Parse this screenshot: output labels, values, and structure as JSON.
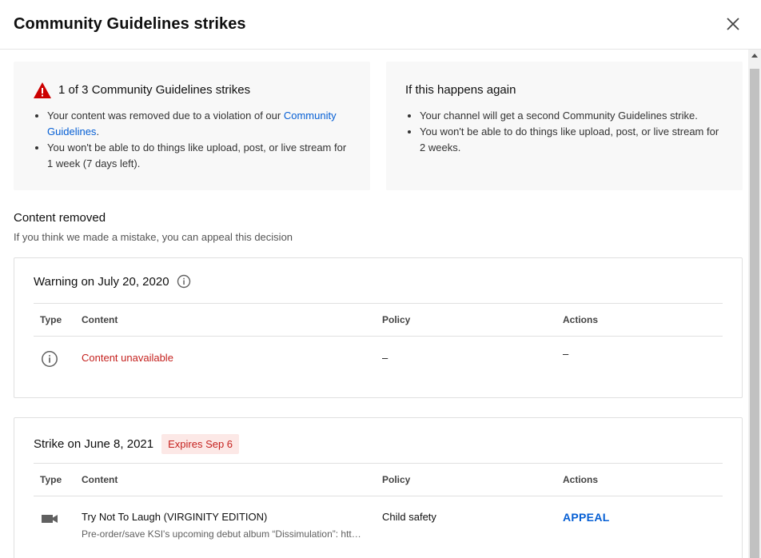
{
  "dialog": {
    "title": "Community Guidelines strikes"
  },
  "current_status": {
    "heading": "1 of 3 Community Guidelines strikes",
    "bullet1_text": "Your content was removed due to a violation of our ",
    "bullet1_link": "Community Guidelines",
    "bullet1_end": ".",
    "bullet2": "You won't be able to do things like upload, post, or live stream for 1 week (7 days left)."
  },
  "if_again": {
    "heading": "If this happens again",
    "bullet1": "Your channel will get a second Community Guidelines strike.",
    "bullet2": "You won't be able to do things like upload, post, or live stream for 2 weeks."
  },
  "content_removed": {
    "title": "Content removed",
    "subtitle": "If you think we made a mistake, you can appeal this decision"
  },
  "table_headers": {
    "type": "Type",
    "content": "Content",
    "policy": "Policy",
    "actions": "Actions"
  },
  "warning": {
    "heading": "Warning on July 20, 2020",
    "content": "Content unavailable",
    "policy": "–",
    "actions": "–"
  },
  "strike": {
    "heading": "Strike on June 8, 2021",
    "badge": "Expires Sep 6",
    "video_title": "Try Not To Laugh (VIRGINITY EDITION)",
    "video_desc": "Pre-order/save KSI's upcoming debut album “Dissimulation”: https://ksi.lnk.to/dissimulation",
    "policy": "Child safety",
    "action": "APPEAL"
  },
  "colors": {
    "link": "#065fd4",
    "error": "#c5221f",
    "badge_bg": "#fce8e6"
  }
}
